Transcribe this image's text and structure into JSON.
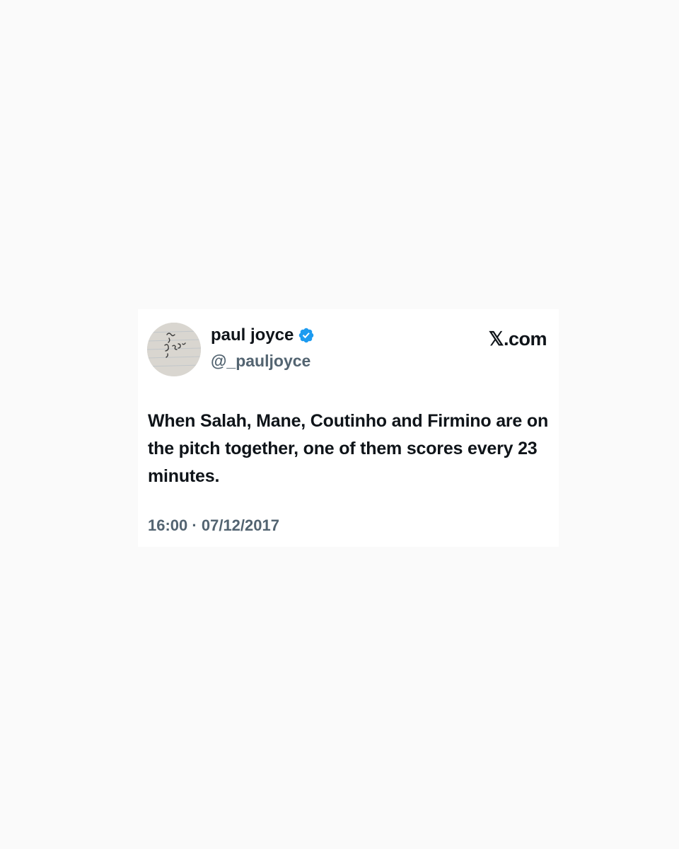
{
  "tweet": {
    "author": {
      "display_name": "paul joyce",
      "handle": "@_pauljoyce",
      "verified": true,
      "verified_color": "#1d9bf0"
    },
    "brand": "𝕏.com",
    "text": "When Salah, Mane, Coutinho and Firmino are on the pitch together, one of them scores every 23 minutes.",
    "time": "16:00",
    "separator": "·",
    "date": "07/12/2017"
  },
  "colors": {
    "page_background": "#fafafa",
    "card_background": "#ffffff",
    "primary_text": "#0f1419",
    "secondary_text": "#536471"
  }
}
